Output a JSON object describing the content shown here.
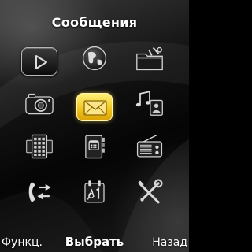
{
  "header": {
    "title": "Сообщения"
  },
  "menu": {
    "selected": "messages",
    "items": [
      {
        "id": "media-player",
        "icon": "play-icon"
      },
      {
        "id": "internet",
        "icon": "globe-icon"
      },
      {
        "id": "gallery",
        "icon": "folder-icon"
      },
      {
        "id": "camera",
        "icon": "camera-icon"
      },
      {
        "id": "messages",
        "icon": "envelope-icon"
      },
      {
        "id": "music-contacts",
        "icon": "music-note-contact-icon"
      },
      {
        "id": "organizer",
        "icon": "organizer-icon"
      },
      {
        "id": "phonebook",
        "icon": "phonebook-icon"
      },
      {
        "id": "radio",
        "icon": "radio-icon"
      },
      {
        "id": "calls",
        "icon": "call-log-icon"
      },
      {
        "id": "calendar",
        "icon": "calendar-icon"
      },
      {
        "id": "settings",
        "icon": "tools-icon"
      }
    ]
  },
  "softkeys": {
    "left": "Функц.",
    "center": "Выбрать",
    "right": "Назад"
  },
  "colors": {
    "accent": "#f5c723",
    "tile_border": "#b8b8b8",
    "background": "#000000"
  }
}
